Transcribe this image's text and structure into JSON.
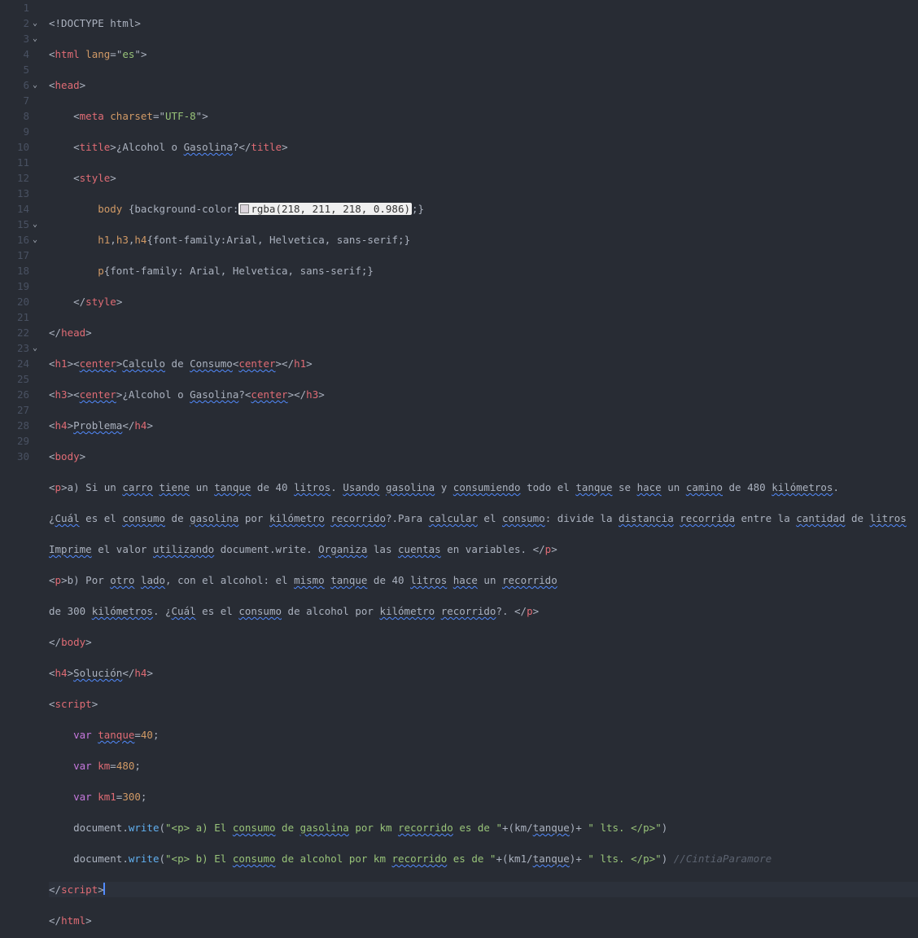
{
  "gutter": {
    "lines": [
      "1",
      "2",
      "3",
      "4",
      "5",
      "6",
      "7",
      "8",
      "9",
      "10",
      "11",
      "12",
      "13",
      "14",
      "15",
      "16",
      "17",
      "18",
      "19",
      "20",
      "21",
      "22",
      "23",
      "24",
      "25",
      "26",
      "27",
      "28",
      "29",
      "30"
    ],
    "fold_markers_on": [
      2,
      3,
      6,
      15,
      16,
      23
    ]
  },
  "code": {
    "l1": {
      "doctype": "<!DOCTYPE html>"
    },
    "l2": {
      "open": "<",
      "tag": "html",
      "sp": " ",
      "attr": "lang",
      "eq": "=",
      "q": "\"",
      "val": "es",
      "close": ">"
    },
    "l3": {
      "open": "<",
      "tag": "head",
      "close": ">"
    },
    "l4": {
      "open": "<",
      "tag": "meta",
      "sp": " ",
      "attr": "charset",
      "eq": "=",
      "q": "\"",
      "val": "UTF-8",
      "close": ">"
    },
    "l5": {
      "o": "<",
      "t": "title",
      "c": ">",
      "txt1": "¿Alcohol o ",
      "txt2": "Gasolina",
      "txt3": "?",
      "co": "</",
      "ct": "title",
      "cc": ">"
    },
    "l6": {
      "o": "<",
      "t": "style",
      "c": ">"
    },
    "l7": {
      "sel": "body",
      "ob": " {",
      "prop": "background-color",
      "col": ":",
      "rgba": "rgba(218, 211, 218, 0.986)",
      "sc": ";",
      "cb": "}"
    },
    "l8": {
      "sel1": "h1",
      "cm1": ",",
      "sel2": "h3",
      "cm2": ",",
      "sel3": "h4",
      "ob": "{",
      "prop": "font-family",
      "col": ":",
      "val": "Arial, Helvetica, sans-serif",
      "sc": ";",
      "cb": "}"
    },
    "l9": {
      "sel": "p",
      "ob": "{",
      "prop": "font-family",
      "col": ": ",
      "val": "Arial, Helvetica, sans-serif",
      "sc": ";",
      "cb": "}"
    },
    "l10": {
      "o": "</",
      "t": "style",
      "c": ">"
    },
    "l11": {
      "o": "</",
      "t": "head",
      "c": ">"
    },
    "l12": {
      "o1": "<",
      "t1": "h1",
      "c1": ">",
      "o2": "<",
      "t2": "center",
      "c2": ">",
      "txt1": "Calculo",
      "sp1": " de ",
      "txt2": "Consumo",
      "o3": "<",
      "t3": "center",
      "c3": ">",
      "o4": "</",
      "t4": "h1",
      "c4": ">"
    },
    "l13": {
      "o1": "<",
      "t1": "h3",
      "c1": ">",
      "o2": "<",
      "t2": "center",
      "c2": ">",
      "txt1": "¿Alcohol o ",
      "txt2": "Gasolina",
      "txt3": "?",
      "o3": "<",
      "t3": "center",
      "c3": ">",
      "o4": "</",
      "t4": "h3",
      "c4": ">"
    },
    "l14": {
      "o1": "<",
      "t1": "h4",
      "c1": ">",
      "txt": "Problema",
      "o2": "</",
      "t2": "h4",
      "c2": ">"
    },
    "l15": {
      "o": "<",
      "t": "body",
      "c": ">"
    },
    "l16": {
      "o": "<",
      "t": "p",
      "c": ">",
      "a": "a) Si un ",
      "carro": "carro",
      "b": " ",
      "tiene": "tiene",
      "c2": " un ",
      "tanque": "tanque",
      "d": " de 40 ",
      "litros": "litros",
      "e": ". ",
      "usando": "Usando",
      "f": " ",
      "gasolina": "gasolina",
      "g": " y ",
      "cons": "consumiendo",
      "h": " todo el ",
      "tanque2": "tanque",
      "i": " se ",
      "hace": "hace",
      "j": " un ",
      "camino": "camino",
      "k": " de 480 ",
      "kil": "kilómetros",
      "l": "."
    },
    "l17": {
      "a": "¿",
      "cual": "Cuál",
      "b": " es el ",
      "cons": "consumo",
      "c2": " de ",
      "gas": "gasolina",
      "d": " por ",
      "kil": "kilómetro",
      "e": " ",
      "rec": "recorrido",
      "f": "?.Para ",
      "calc": "calcular",
      "g": " el ",
      "cons2": "consumo",
      "h": ": divide la ",
      "dist": "distancia",
      "i": " ",
      "reco": "recorrida",
      "j": " entre la ",
      "cant": "cantidad",
      "k": " de ",
      "lit": "litros",
      "l": " "
    },
    "l18": {
      "a": "Imprime",
      "b": " el valor ",
      "util": "utilizando",
      "c2": " document.write. ",
      "org": "Organiza",
      "d": " las ",
      "cuen": "cuentas",
      "e": " en variables. ",
      "co": "</",
      "ct": "p",
      "cc": ">"
    },
    "l19": {
      "o": "<",
      "t": "p",
      "c": ">",
      "a": "b) Por ",
      "otro": "otro",
      "b": " ",
      "lado": "lado",
      "c2": ", con el alcohol: el ",
      "mismo": "mismo",
      "d": " ",
      "tanque": "tanque",
      "e": " de 40 ",
      "lit": "litros",
      "f": " ",
      "hace": "hace",
      "g": " un ",
      "rec": "recorrido"
    },
    "l20": {
      "a": "de 300 ",
      "kil": "kilómetros",
      "b": ". ¿",
      "cual": "Cuál",
      "c2": " es el ",
      "cons": "consumo",
      "d": " de alcohol por ",
      "kilm": "kilómetro",
      "e": " ",
      "rec": "recorrido",
      "f": "?. ",
      "co": "</",
      "ct": "p",
      "cc": ">"
    },
    "l21": {
      "o": "</",
      "t": "body",
      "c": ">"
    },
    "l22": {
      "o1": "<",
      "t1": "h4",
      "c1": ">",
      "txt": "Solución",
      "o2": "</",
      "t2": "h4",
      "c2": ">"
    },
    "l23": {
      "o": "<",
      "t": "script",
      "c": ">"
    },
    "l24": {
      "kw": "var",
      "sp": " ",
      "id": "tanque",
      "eq": "=",
      "num": "40",
      "sc": ";"
    },
    "l25": {
      "kw": "var",
      "sp": " ",
      "id": "km",
      "eq": "=",
      "num": "480",
      "sc": ";"
    },
    "l26": {
      "kw": "var",
      "sp": " ",
      "id": "km1",
      "eq": "=",
      "num": "300",
      "sc": ";"
    },
    "l27": {
      "obj": "document",
      "dot": ".",
      "fn": "write",
      "op": "(",
      "str1": "\"<p> a) El ",
      "s_cons": "consumo",
      "str2": " de ",
      "s_gas": "gasolina",
      "str3": " por km ",
      "s_rec": "recorrido",
      "str4": " es de \"",
      "plus1": "+",
      "pp": "(",
      "v1": "km",
      "sl": "/",
      "v2": "tanque",
      "cp2": ")",
      "plus2": "+",
      "str5": " \" lts. </p>\"",
      "cp": ")"
    },
    "l28": {
      "obj": "document",
      "dot": ".",
      "fn": "write",
      "op": "(",
      "str1": "\"<p> b) El ",
      "s_cons": "consumo",
      "str2": " de alcohol por km ",
      "s_rec": "recorrido",
      "str3": " es de \"",
      "plus1": "+",
      "pp": "(",
      "v1": "km1",
      "sl": "/",
      "v2": "tanque",
      "cp2": ")",
      "plus2": "+",
      "str4": " \" lts. </p>\"",
      "cp": ")",
      "sp": " ",
      "com": "//CintiaParamore"
    },
    "l29": {
      "o": "</",
      "t": "script",
      "c": ">"
    },
    "l30": {
      "o": "</",
      "t": "html",
      "c": ">"
    }
  }
}
